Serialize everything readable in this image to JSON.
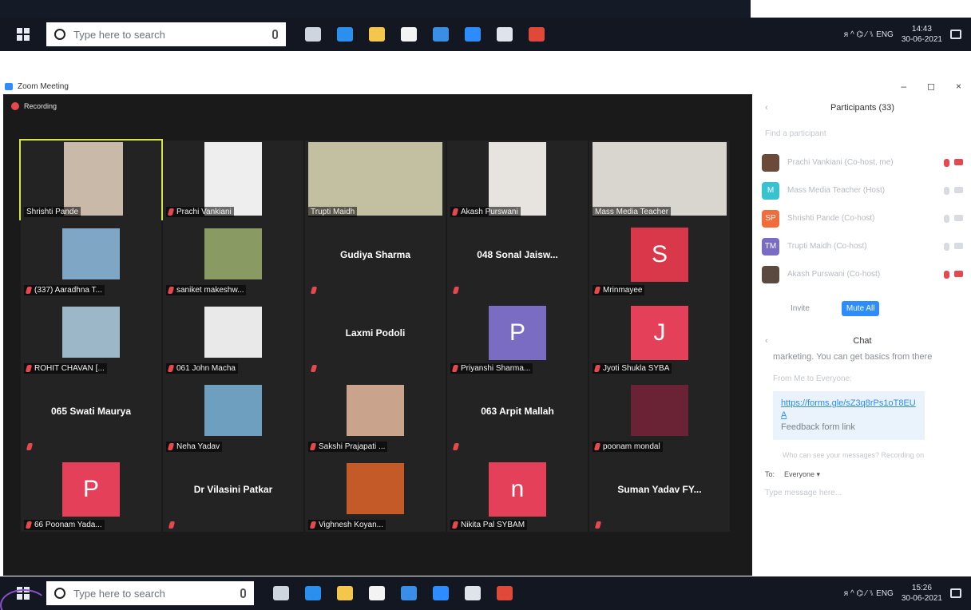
{
  "taskbar_top": {
    "search_placeholder": "Type here to search",
    "tray_icons": "ᴙ  ^  ⌬  ⁄  ⑊  ENG",
    "time": "14:43",
    "date": "30-06-2021"
  },
  "taskbar_bottom": {
    "search_placeholder": "Type here to search",
    "tray_icons": "ᴙ  ^  ⌬  ⁄  ⑊  ENG",
    "time": "15:26",
    "date": "30-06-2021"
  },
  "taskbar_apps": [
    {
      "icon": "task-view-icon",
      "color": "#cfd5de"
    },
    {
      "icon": "edge-icon",
      "color": "#2b8ff0"
    },
    {
      "icon": "file-explorer-icon",
      "color": "#f4c64b"
    },
    {
      "icon": "store-icon",
      "color": "#f3f3f3"
    },
    {
      "icon": "mail-icon",
      "color": "#3a8ee6"
    },
    {
      "icon": "zoom-icon",
      "color": "#2d8cff"
    },
    {
      "icon": "settings-icon",
      "color": "#dfe3ea"
    },
    {
      "icon": "chrome-icon",
      "color": "#e0493a"
    }
  ],
  "window": {
    "title": "Zoom Meeting",
    "minimize": "–",
    "maximize": "◻",
    "close": "×"
  },
  "recording_label": "Recording",
  "tiles": [
    {
      "name": "Shrishti Pande",
      "kind": "video",
      "active": true,
      "color": "#c9b9a8"
    },
    {
      "name": "Prachi Vankiani",
      "kind": "video",
      "color": "#eeeeee"
    },
    {
      "name": "Trupti Maidh",
      "kind": "video",
      "color": "#c3c0a2"
    },
    {
      "name": "Akash Purswani",
      "kind": "video",
      "color": "#e7e3df"
    },
    {
      "name": "Mass Media Teacher",
      "kind": "video",
      "color": "#d9d6cf"
    },
    {
      "name": "(337) Aaradhna T...",
      "kind": "photo",
      "color": "#7fa6c4"
    },
    {
      "name": "saniket makeshw...",
      "kind": "photo",
      "color": "#8a9a63"
    },
    {
      "name": "Gudiya Sharma",
      "kind": "name"
    },
    {
      "name": "048 Sonal Jaisw...",
      "kind": "name"
    },
    {
      "name": "Mrinmayee",
      "kind": "initial",
      "letter": "S",
      "color": "#d9374a"
    },
    {
      "name": "ROHIT CHAVAN [...",
      "kind": "photo",
      "color": "#9bb7c8"
    },
    {
      "name": "061 John Macha",
      "kind": "photo",
      "color": "#e9e9e9"
    },
    {
      "name": "Laxmi Podoli",
      "kind": "name"
    },
    {
      "name": "Priyanshi Sharma...",
      "kind": "initial",
      "letter": "P",
      "color": "#7b6cc3"
    },
    {
      "name": "Jyoti Shukla SYBA",
      "kind": "initial",
      "letter": "J",
      "color": "#e4405a"
    },
    {
      "name": "065 Swati Maurya",
      "kind": "name"
    },
    {
      "name": "Neha Yadav",
      "kind": "photo",
      "color": "#6f9fbf"
    },
    {
      "name": "Sakshi Prajapati ...",
      "kind": "photo",
      "color": "#c9a38c"
    },
    {
      "name": "063 Arpit Mallah",
      "kind": "name"
    },
    {
      "name": "poonam mondal",
      "kind": "photo",
      "color": "#6a2334"
    },
    {
      "name": "66 Poonam Yada...",
      "kind": "initial",
      "letter": "P",
      "color": "#e4405a"
    },
    {
      "name": "Dr Vilasini Patkar",
      "kind": "name"
    },
    {
      "name": "Vighnesh Koyan...",
      "kind": "photo",
      "color": "#c45a27"
    },
    {
      "name": "Nikita Pal SYBAM",
      "kind": "initial",
      "letter": "n",
      "color": "#e4405a"
    },
    {
      "name": "Suman Yadav FY...",
      "kind": "name"
    }
  ],
  "participants": {
    "title": "Participants (33)",
    "find_placeholder": "Find a participant",
    "list": [
      {
        "name": "Prachi Vankiani (Co-host, me)",
        "avatar_text": "",
        "avatar_color": "#6b4a3a",
        "mic_color": "#e5484d",
        "cam_color": "#e5484d"
      },
      {
        "name": "Mass Media Teacher (Host)",
        "avatar_text": "M",
        "avatar_color": "#38c1cf",
        "mic_color": "#d8dbe0",
        "cam_color": "#d8dbe0"
      },
      {
        "name": "Shrishti Pande (Co-host)",
        "avatar_text": "SP",
        "avatar_color": "#f26b3a",
        "mic_color": "#d8dbe0",
        "cam_color": "#d8dbe0"
      },
      {
        "name": "Trupti Maidh (Co-host)",
        "avatar_text": "TM",
        "avatar_color": "#7b6cc3",
        "mic_color": "#d8dbe0",
        "cam_color": "#d8dbe0"
      },
      {
        "name": "Akash Purswani (Co-host)",
        "avatar_text": "",
        "avatar_color": "#5b4a3f",
        "mic_color": "#e5484d",
        "cam_color": "#e5484d"
      }
    ],
    "invite_label": "Invite",
    "mute_all_label": "Mute All"
  },
  "chat": {
    "title": "Chat",
    "partial_message": "marketing. You can get basics from there",
    "from_line": "From Me to Everyone:",
    "link": "https://forms.gle/sZ3q8rPs1oT8EUA",
    "link_caption": "Feedback form link",
    "hint": "Who can see your messages? Recording on",
    "to_label": "To:",
    "recipient": "Everyone ▾",
    "input_placeholder": "Type message here..."
  }
}
